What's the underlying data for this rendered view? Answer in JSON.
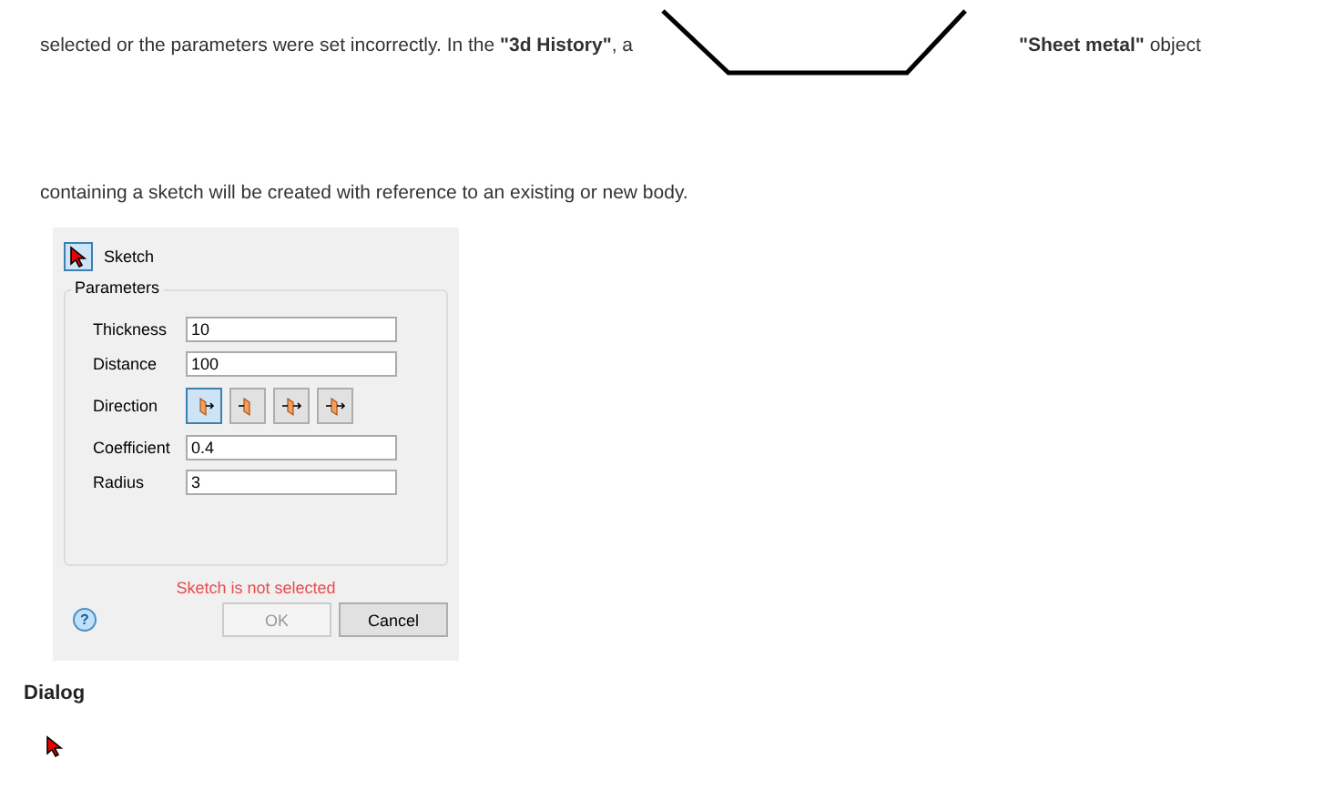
{
  "intro": {
    "before": "selected or the parameters were set incorrectly. In the **\"3d History\"**, a",
    "after": "**\"Sheet metal\"** object",
    "continuation": "containing a sketch will be created with reference to an existing or new body."
  },
  "dialog": {
    "sketch_label": "Sketch",
    "group_title": "Parameters",
    "fields": [
      {
        "kind": "input",
        "label": "Thickness",
        "value": "10"
      },
      {
        "kind": "input",
        "label": "Distance",
        "value": "100"
      },
      {
        "kind": "direction",
        "label": "Direction",
        "options": [
          {
            "selected": true
          },
          {
            "selected": false
          },
          {
            "selected": false
          },
          {
            "selected": false
          }
        ]
      },
      {
        "kind": "input",
        "label": "Coefficient",
        "value": "0.4"
      },
      {
        "kind": "input",
        "label": "Radius",
        "value": "3"
      }
    ],
    "error": "Sketch is not selected",
    "help": "?",
    "buttons": [
      {
        "label": "OK",
        "disabled": true
      },
      {
        "label": "Cancel",
        "disabled": false
      }
    ]
  },
  "caption": "Dialog"
}
